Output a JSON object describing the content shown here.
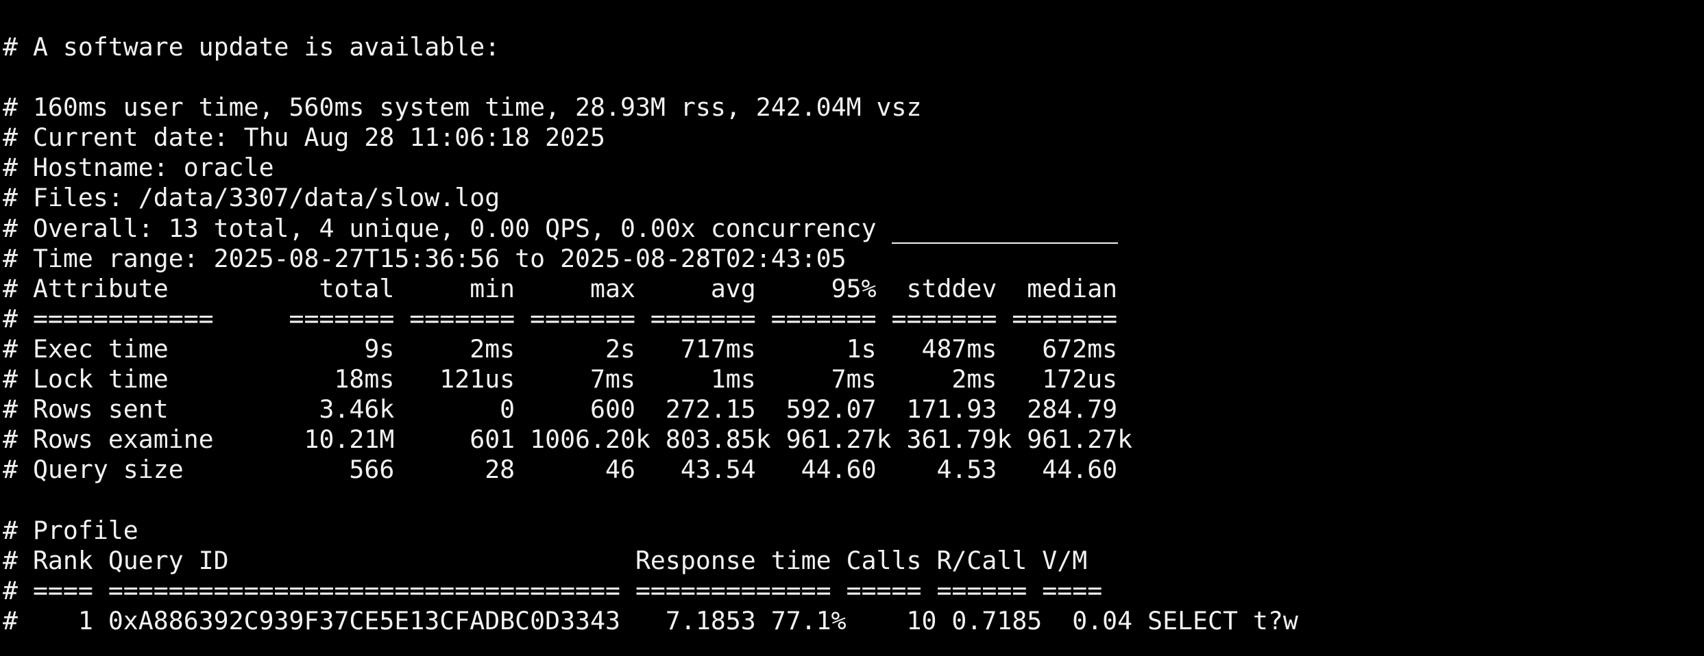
{
  "terminal": {
    "background": "#000000",
    "foreground": "#f2f2f2",
    "lines": [
      "# A software update is available:",
      "",
      "# 160ms user time, 560ms system time, 28.93M rss, 242.04M vsz",
      "# Current date: Thu Aug 28 11:06:18 2025",
      "# Hostname: oracle",
      "# Files: /data/3307/data/slow.log",
      "# Overall: 13 total, 4 unique, 0.00 QPS, 0.00x concurrency ",
      "# Time range: 2025-08-27T15:36:56 to 2025-08-28T02:43:05",
      "# Attribute          total     min     max     avg     95%  stddev  median",
      "# ============     ======= ======= ======= ======= ======= ======= =======",
      "# Exec time             9s     2ms      2s   717ms      1s   487ms   672ms",
      "# Lock time           18ms   121us     7ms     1ms     7ms     2ms   172us",
      "# Rows sent          3.46k       0     600  272.15  592.07  171.93  284.79",
      "# Rows examine      10.21M     601 1006.20k 803.85k 961.27k 361.79k 961.27k",
      "# Query size           566      28      46   43.54   44.60    4.53   44.60",
      "",
      "# Profile",
      "# Rank Query ID                           Response time Calls R/Call V/M",
      "# ==== ================================== ============= ===== ====== ====",
      "#    1 0xA886392C939F37CE5E13CFADBC0D3343   7.1853 77.1%    10 0.7185  0.04 SELECT t?w"
    ]
  }
}
